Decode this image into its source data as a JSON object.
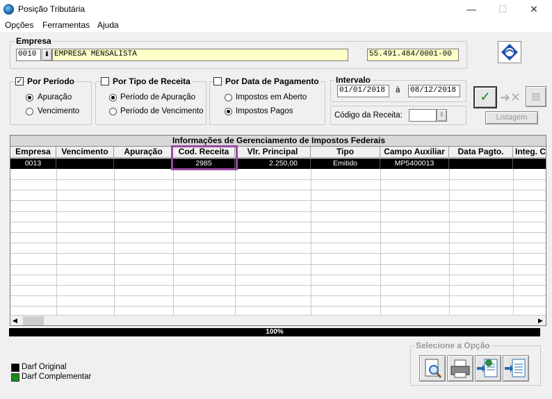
{
  "window": {
    "title": "Posição Tributária",
    "minimize": "—",
    "maximize": "☐",
    "close": "✕"
  },
  "menu": [
    "Opções",
    "Ferramentas",
    "Ajuda"
  ],
  "empresa": {
    "legend": "Empresa",
    "code": "0010",
    "name": "EMPRESA MENSALISTA",
    "cnpj": "55.491.484/0001-00"
  },
  "filters": {
    "por_periodo": {
      "label": "Por Período",
      "checked": true,
      "options": [
        "Apuração",
        "Vencimento"
      ],
      "selected": 0
    },
    "por_tipo": {
      "label": "Por Tipo de Receita",
      "checked": false,
      "options": [
        "Período de Apuração",
        "Período de Vencimento"
      ],
      "selected": 0
    },
    "por_data": {
      "label": "Por Data de Pagamento",
      "checked": false,
      "options": [
        "Impostos em Aberto",
        "Impostos Pagos"
      ],
      "selected": 1
    }
  },
  "intervalo": {
    "legend": "Intervalo",
    "from": "01/01/2018",
    "sep": "à",
    "to": "08/12/2018",
    "codigo_label": "Código da Receita:",
    "codigo_value": ""
  },
  "toolbar": {
    "listagem": "Listagem"
  },
  "grid": {
    "title": "Informações de Gerenciamento de Impostos Federais",
    "columns": [
      "Empresa",
      "Vencimento",
      "Apuração",
      "Cod. Receita",
      "Vlr. Principal",
      "Tipo",
      "Campo Auxiliar",
      "Data Pagto.",
      "Integ. C"
    ],
    "rows": [
      [
        "0013",
        "",
        "",
        "2985",
        "2.250,00",
        "Emitido",
        "MP5400013",
        "",
        ""
      ]
    ]
  },
  "progress": {
    "value": "100%"
  },
  "legend_items": [
    {
      "label": "Darf Original",
      "color": "#000000"
    },
    {
      "label": "Darf Complementar",
      "color": "#1a8a1a"
    }
  ],
  "selecione": {
    "legend": "Selecione a Opção"
  }
}
